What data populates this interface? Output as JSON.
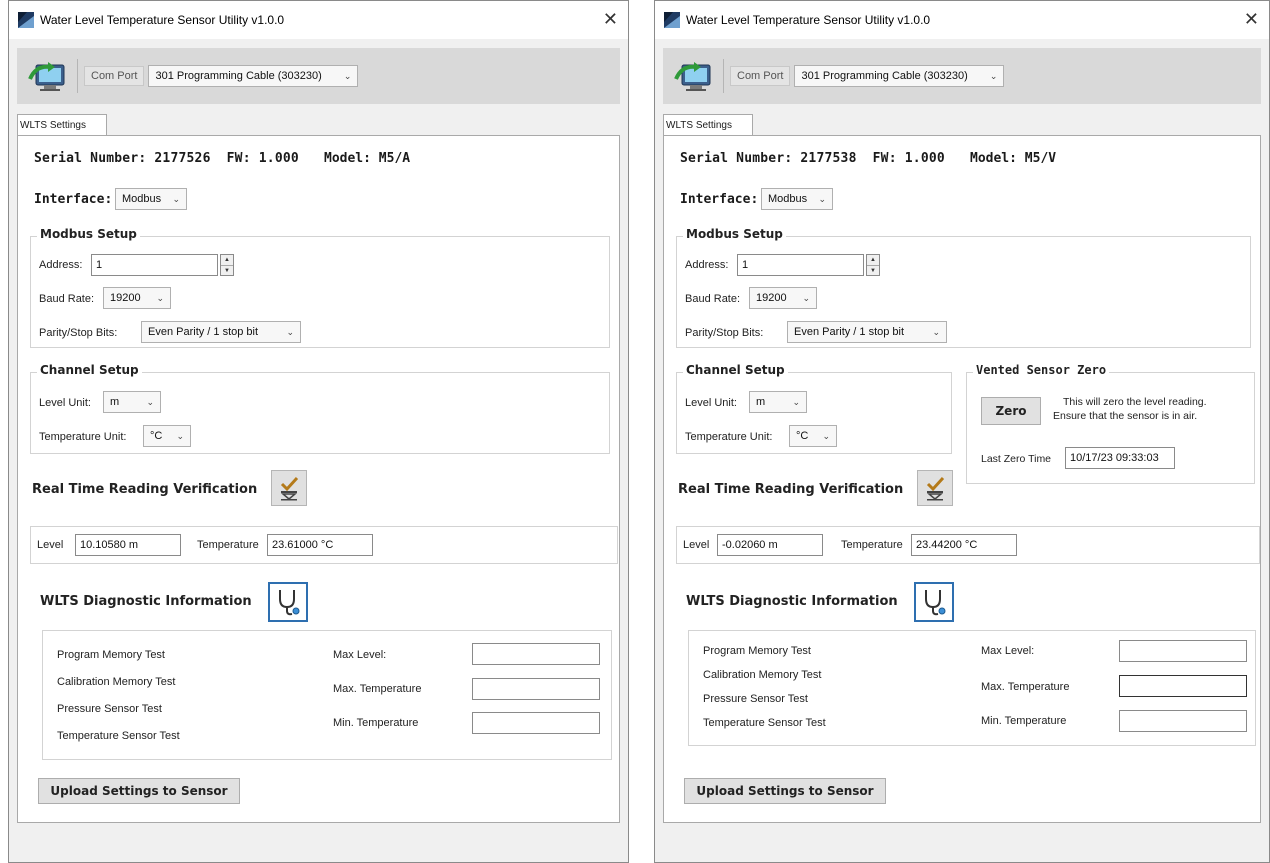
{
  "windows": [
    {
      "title": "Water Level Temperature Sensor Utility v1.0.0",
      "close_glyph": "✕",
      "com_port_label": "Com Port",
      "com_port_value": "301 Programming Cable (303230)",
      "tab_label": "WLTS Settings",
      "serial_label": "Serial Number:",
      "serial_value": "2177526",
      "fw_label": "FW:",
      "fw_value": "1.000",
      "model_label": "Model:",
      "model_value": "M5/A",
      "interface_label": "Interface:",
      "interface_value": "Modbus",
      "modbus_setup_title": "Modbus Setup",
      "address_label": "Address:",
      "address_value": "1",
      "baud_label": "Baud Rate:",
      "baud_value": "19200",
      "parity_label": "Parity/Stop Bits:",
      "parity_value": "Even Parity / 1 stop bit",
      "channel_setup_title": "Channel Setup",
      "level_unit_label": "Level Unit:",
      "level_unit_value": "m",
      "temp_unit_label": "Temperature Unit:",
      "temp_unit_value": "°C",
      "rt_title": "Real Time Reading Verification",
      "level_label": "Level",
      "level_value": "10.10580 m",
      "temperature_label": "Temperature",
      "temperature_value": "23.61000 °C",
      "diag_title": "WLTS Diagnostic Information",
      "program_memory_test": "Program Memory Test",
      "calibration_memory_test": "Calibration Memory Test",
      "pressure_sensor_test": "Pressure Sensor Test",
      "temperature_sensor_test": "Temperature Sensor Test",
      "max_level_label": "Max Level:",
      "max_temp_label": "Max. Temperature",
      "min_temp_label": "Min. Temperature",
      "upload_button": "Upload Settings to Sensor"
    },
    {
      "title": "Water Level Temperature Sensor Utility v1.0.0",
      "close_glyph": "✕",
      "com_port_label": "Com Port",
      "com_port_value": "301 Programming Cable (303230)",
      "tab_label": "WLTS Settings",
      "serial_label": "Serial Number:",
      "serial_value": "2177538",
      "fw_label": "FW:",
      "fw_value": "1.000",
      "model_label": "Model:",
      "model_value": "M5/V",
      "interface_label": "Interface:",
      "interface_value": "Modbus",
      "modbus_setup_title": "Modbus Setup",
      "address_label": "Address:",
      "address_value": "1",
      "baud_label": "Baud Rate:",
      "baud_value": "19200",
      "parity_label": "Parity/Stop Bits:",
      "parity_value": "Even Parity / 1 stop bit",
      "channel_setup_title": "Channel Setup",
      "level_unit_label": "Level Unit:",
      "level_unit_value": "m",
      "temp_unit_label": "Temperature Unit:",
      "temp_unit_value": "°C",
      "vented_title": "Vented Sensor Zero",
      "zero_button": "Zero",
      "zero_note_1": "This will zero the level reading.",
      "zero_note_2": "Ensure that the sensor is in air.",
      "last_zero_label": "Last Zero Time",
      "last_zero_value": "10/17/23 09:33:03",
      "rt_title": "Real Time Reading Verification",
      "level_label": "Level",
      "level_value": "-0.02060 m",
      "temperature_label": "Temperature",
      "temperature_value": "23.44200 °C",
      "diag_title": "WLTS Diagnostic Information",
      "program_memory_test": "Program Memory Test",
      "calibration_memory_test": "Calibration Memory Test",
      "pressure_sensor_test": "Pressure Sensor Test",
      "temperature_sensor_test": "Temperature Sensor Test",
      "max_level_label": "Max Level:",
      "max_temp_label": "Max. Temperature",
      "min_temp_label": "Min. Temperature",
      "upload_button": "Upload Settings to Sensor"
    }
  ],
  "icons": {
    "app": "app-logo-icon",
    "connect": "connect-computer-icon",
    "verify": "checkmark-verify-icon",
    "diagnostic": "stethoscope-icon",
    "chevron": "chevron-down-icon",
    "spinner": "spinner-arrows-icon"
  },
  "colors": {
    "window_bg": "#f0f0f0",
    "toolbar_bg": "#d9d9d9",
    "panel_bg": "#ffffff",
    "accent_blue": "#2e6fb0"
  }
}
